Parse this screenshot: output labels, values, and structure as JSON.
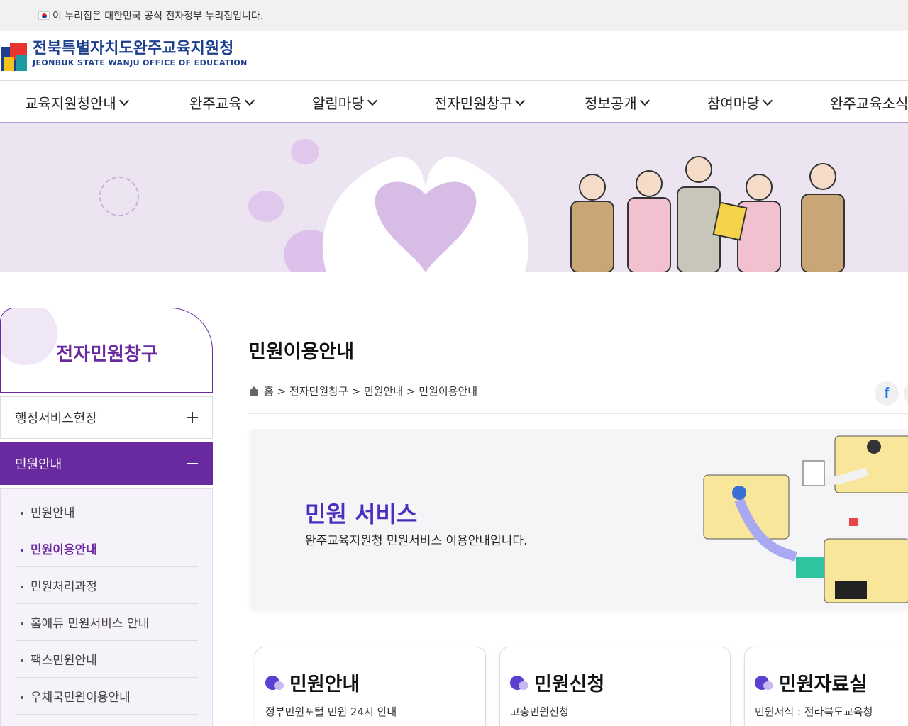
{
  "gov_strip": {
    "text": "이 누리집은 대한민국 공식 전자정부 누리집입니다."
  },
  "logo": {
    "ko": "전북특별자치도완주교육지원청",
    "en": "JEONBUK STATE WANJU OFFICE OF EDUCATION"
  },
  "gnb": [
    {
      "label": "교육지원청안내"
    },
    {
      "label": "완주교육"
    },
    {
      "label": "알림마당"
    },
    {
      "label": "전자민원창구"
    },
    {
      "label": "정보공개"
    },
    {
      "label": "참여마당"
    },
    {
      "label": "완주교육소식"
    }
  ],
  "sidebar": {
    "title": "전자민원창구",
    "items": [
      {
        "label": "행정서비스헌장"
      },
      {
        "label": "민원안내"
      }
    ],
    "sub_items": [
      {
        "label": "민원안내"
      },
      {
        "label": "민원이용안내"
      },
      {
        "label": "민원처리과정"
      },
      {
        "label": "홈에듀 민원서비스 안내"
      },
      {
        "label": "팩스민원안내"
      },
      {
        "label": "우체국민원이용안내"
      }
    ]
  },
  "main": {
    "title": "민원이용안내",
    "breadcrumb": [
      "홈",
      ">",
      "전자민원창구",
      ">",
      "민원안내",
      ">",
      "민원이용안내"
    ],
    "share_label": "f",
    "service": {
      "title": "민원 서비스",
      "desc": "완주교육지원청 민원서비스 이용안내입니다."
    },
    "cards": [
      {
        "title": "민원안내",
        "text": "정부민원포털 민원 24시 안내"
      },
      {
        "title": "민원신청",
        "text": "고충민원신청"
      },
      {
        "title": "민원자료실",
        "text": "민원서식 : 전라북도교육청"
      }
    ]
  },
  "colors": {
    "accent": "#6a2a9f",
    "service_title": "#4b2dbf",
    "brand_blue": "#1d3f8f"
  }
}
